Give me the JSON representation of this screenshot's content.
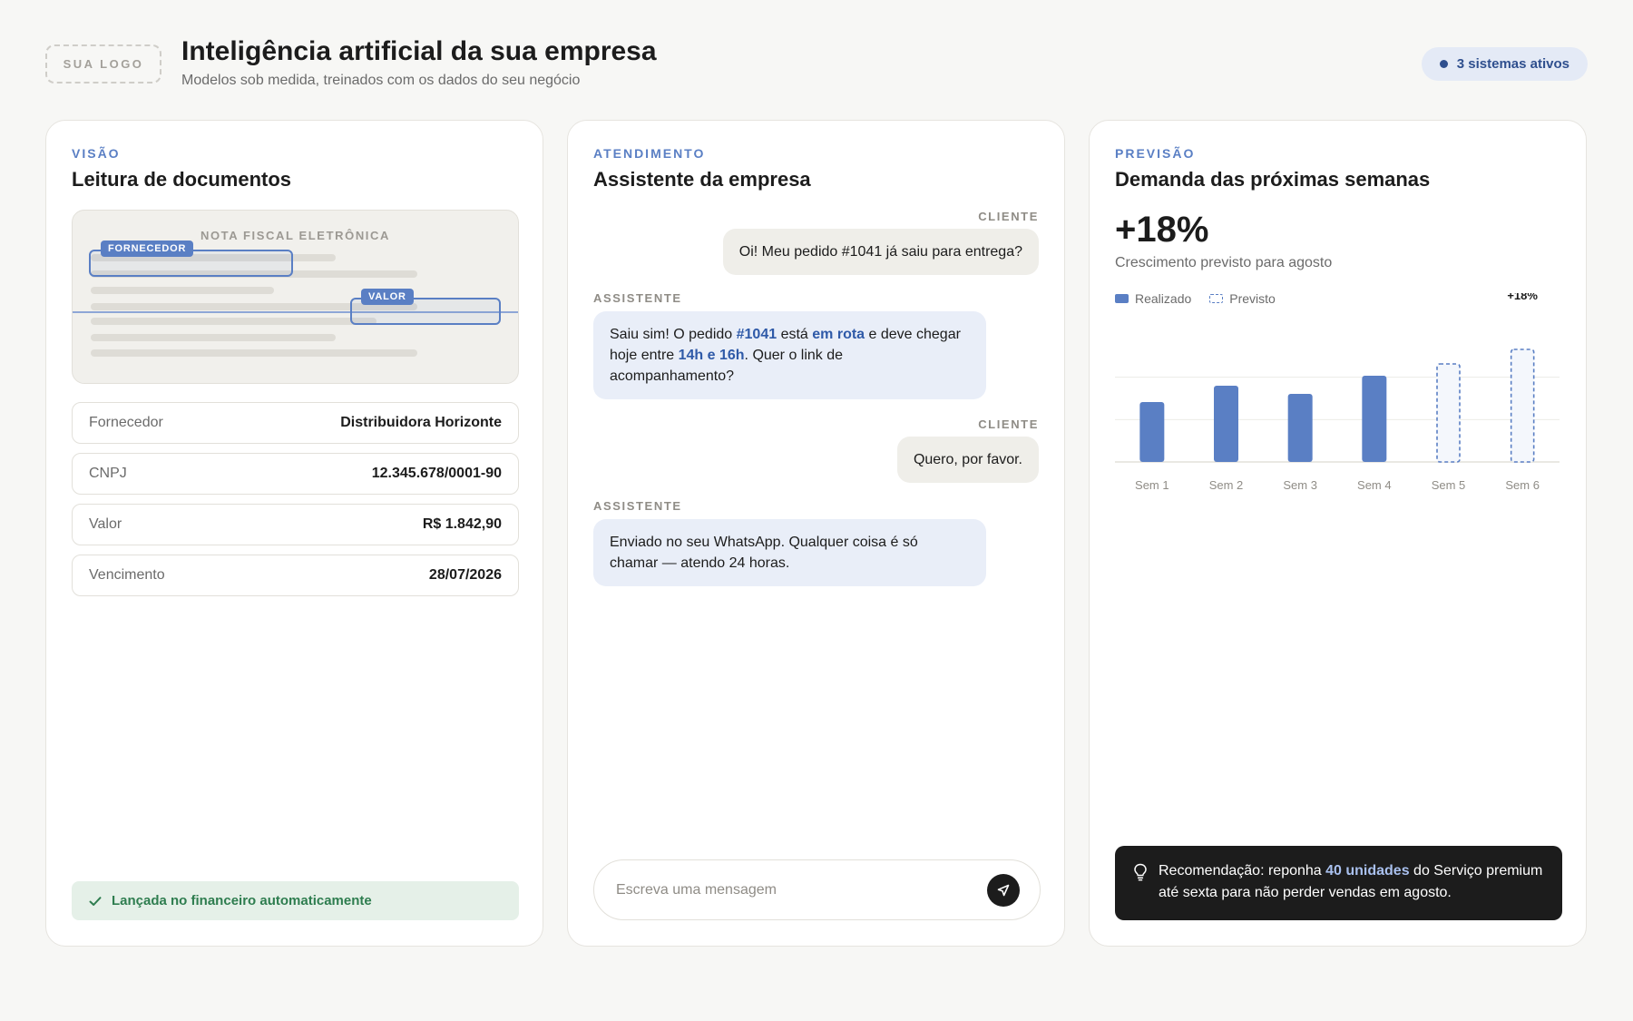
{
  "header": {
    "logo_label": "SUA LOGO",
    "title": "Inteligência artificial da sua empresa",
    "subtitle": "Modelos sob medida, treinados com os dados do seu negócio",
    "status": "3 sistemas ativos"
  },
  "vision": {
    "eyebrow": "VISÃO",
    "title": "Leitura de documentos",
    "doc_heading": "NOTA FISCAL ELETRÔNICA",
    "tag_supplier": "FORNECEDOR",
    "tag_value": "VALOR",
    "fields": [
      {
        "label": "Fornecedor",
        "value": "Distribuidora Horizonte"
      },
      {
        "label": "CNPJ",
        "value": "12.345.678/0001-90"
      },
      {
        "label": "Valor",
        "value": "R$ 1.842,90"
      },
      {
        "label": "Vencimento",
        "value": "28/07/2026"
      }
    ],
    "success": "Lançada no financeiro automaticamente"
  },
  "chat": {
    "eyebrow": "ATENDIMENTO",
    "title": "Assistente da empresa",
    "role_client": "CLIENTE",
    "role_assistant": "ASSISTENTE",
    "msg1": "Oi! Meu pedido #1041 já saiu para entrega?",
    "msg2": {
      "p1": "Saiu sim! O pedido ",
      "h1": "#1041",
      "p2": " está ",
      "h2": "em rota",
      "p3": " e deve chegar hoje entre ",
      "h3": "14h e 16h",
      "p4": ". Quer o link de acompanhamento?"
    },
    "msg3": "Quero, por favor.",
    "msg4": "Enviado no seu WhatsApp. Qualquer coisa é só chamar — atendo 24 horas.",
    "composer_placeholder": "Escreva uma mensagem"
  },
  "forecast": {
    "eyebrow": "PREVISÃO",
    "title": "Demanda das próximas semanas",
    "big_number": "+18%",
    "caption": "Crescimento previsto para agosto",
    "legend_actual": "Realizado",
    "legend_forecast": "Previsto",
    "recommendation": {
      "p1": "Recomendação: reponha ",
      "h1": "40 unidades",
      "p2": " do Serviço premium até sexta para não perder vendas em agosto."
    }
  },
  "chart_data": {
    "type": "bar",
    "categories": [
      "Sem 1",
      "Sem 2",
      "Sem 3",
      "Sem 4",
      "Sem 5",
      "Sem 6"
    ],
    "series": [
      {
        "name": "Realizado",
        "values": [
          66,
          84,
          75,
          95,
          null,
          null
        ]
      },
      {
        "name": "Previsto",
        "values": [
          null,
          null,
          null,
          null,
          108,
          124
        ]
      }
    ],
    "annotation": {
      "category": "Sem 6",
      "text": "+18%"
    },
    "ylim": [
      0,
      140
    ],
    "grid": true,
    "legend": "top-left",
    "colors": {
      "actual": "#5a7fc4",
      "forecast": "#5a7fc4"
    }
  }
}
